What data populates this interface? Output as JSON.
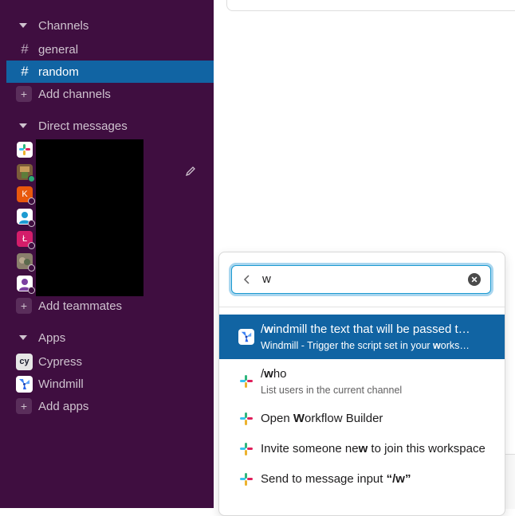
{
  "sidebar": {
    "channels_header": "Channels",
    "channels": [
      {
        "label": "general",
        "active": false
      },
      {
        "label": "random",
        "active": true
      }
    ],
    "add_channels": "Add channels",
    "dm_header": "Direct messages",
    "dm_avatars": [
      "slack-logo-avatar",
      "photo-avatar",
      "K",
      "person-avatar",
      "Ł",
      "photo-avatar",
      "person-avatar"
    ],
    "add_teammates": "Add teammates",
    "apps_header": "Apps",
    "apps": [
      {
        "label": "Cypress",
        "icon": "cy"
      },
      {
        "label": "Windmill",
        "icon": "windmill-icon"
      }
    ],
    "add_apps": "Add apps"
  },
  "search": {
    "value": "w"
  },
  "results": [
    {
      "pre": "/",
      "hl": "w",
      "post": "indmill the text that will be passed t…",
      "sub": "Windmill - Trigger the script set in your ",
      "sub_hl": "w",
      "sub_post": "orks…",
      "selected": true
    },
    {
      "pre": "/",
      "hl": "w",
      "post": "ho",
      "sub": "List users in the current channel",
      "selected": false
    },
    {
      "pre": "Open ",
      "hl": "W",
      "post": "orkflow Builder",
      "selected": false
    },
    {
      "pre": "Invite someone ne",
      "hl": "w",
      "post": " to join this workspace",
      "selected": false
    },
    {
      "pre": "Send to message input ",
      "hl": "“/w”",
      "post": "",
      "selected": false
    }
  ],
  "colors": {
    "sidebar_bg": "#3f0e40",
    "active_item": "#1164a3",
    "focus_ring": "#1d9bd1"
  }
}
